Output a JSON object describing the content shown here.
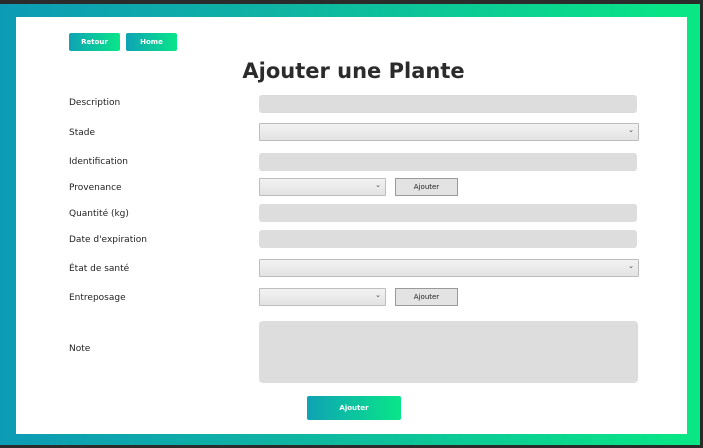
{
  "nav": {
    "back_label": "Retour",
    "home_label": "Home"
  },
  "page": {
    "title": "Ajouter une Plante"
  },
  "form": {
    "description_label": "Description",
    "stade_label": "Stade",
    "identification_label": "Identification",
    "provenance_label": "Provenance",
    "quantite_label": "Quantité (kg)",
    "date_label": "Date d'expiration",
    "etat_label": "État de santé",
    "entreposage_label": "Entreposage",
    "note_label": "Note",
    "add_provenance_label": "Ajouter",
    "add_entreposage_label": "Ajouter",
    "submit_label": "Ajouter",
    "description_value": "",
    "identification_value": "",
    "quantite_value": "",
    "date_value": "",
    "note_value": ""
  },
  "colors": {
    "gradient_start": "#0c9bb5",
    "gradient_end": "#08e884",
    "field_bg": "#dddddd"
  }
}
